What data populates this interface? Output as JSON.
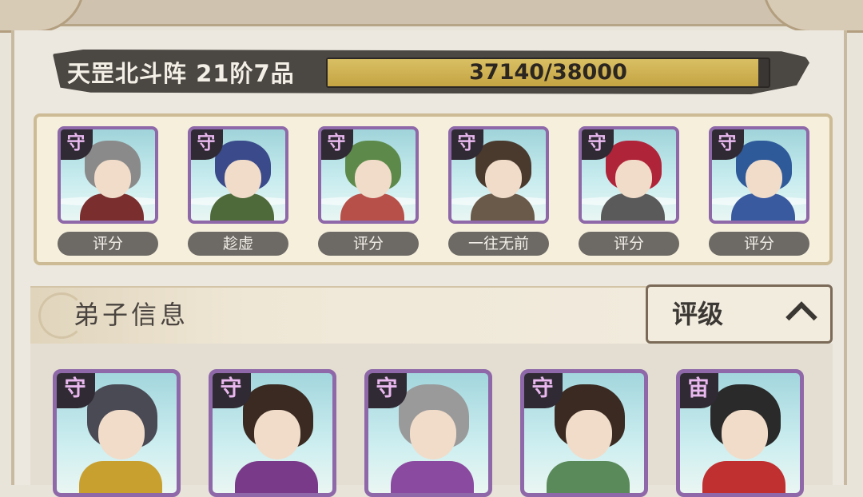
{
  "formation": {
    "title": "天罡北斗阵 21阶7品",
    "progress_text": "37140/38000",
    "progress_fraction": 0.977
  },
  "team": [
    {
      "rank": "守",
      "label": "评分",
      "hair": "#8a8a8a",
      "outfit": "#7a2e2e"
    },
    {
      "rank": "守",
      "label": "趁虚",
      "hair": "#3a4a8a",
      "outfit": "#4f6a3a"
    },
    {
      "rank": "守",
      "label": "评分",
      "hair": "#5d8a4a",
      "outfit": "#b8504a"
    },
    {
      "rank": "守",
      "label": "一往无前",
      "hair": "#4a3a2e",
      "outfit": "#6a5a4a"
    },
    {
      "rank": "守",
      "label": "评分",
      "hair": "#b0243a",
      "outfit": "#5a5a5a"
    },
    {
      "rank": "守",
      "label": "评分",
      "hair": "#2f5a9a",
      "outfit": "#3a5aa0"
    }
  ],
  "section": {
    "title": "弟子信息",
    "sort_label": "评级"
  },
  "disciples": [
    {
      "rank": "守",
      "hair": "#4a4a55",
      "outfit": "#c8a030"
    },
    {
      "rank": "守",
      "hair": "#3a2a22",
      "outfit": "#7a3a8a"
    },
    {
      "rank": "守",
      "hair": "#9a9a9a",
      "outfit": "#8a4aa0"
    },
    {
      "rank": "守",
      "hair": "#3a2a22",
      "outfit": "#5a8a5a"
    },
    {
      "rank": "宙",
      "hair": "#2a2a2a",
      "outfit": "#c03030"
    }
  ]
}
